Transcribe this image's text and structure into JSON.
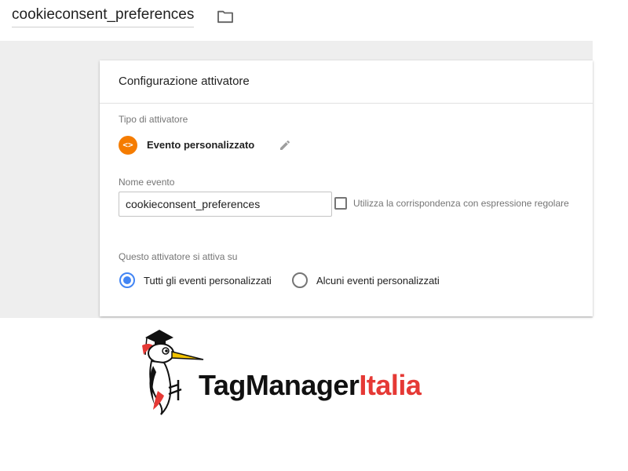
{
  "header": {
    "trigger_name": "cookieconsent_preferences",
    "folder_icon": "folder-icon"
  },
  "card": {
    "title": "Configurazione attivatore",
    "trigger_type": {
      "section_label": "Tipo di attivatore",
      "icon": "code-brackets-icon",
      "icon_glyph": "<>",
      "icon_color": "#f57c00",
      "label": "Evento personalizzato",
      "edit_icon": "pencil-icon"
    },
    "event_name": {
      "label": "Nome evento",
      "value": "cookieconsent_preferences"
    },
    "regex_option": {
      "label": "Utilizza la corrispondenza con espressione regolare",
      "checked": false
    },
    "fires_on": {
      "label": "Questo attivatore si attiva su",
      "options": [
        {
          "label": "Tutti gli eventi personalizzati",
          "selected": true
        },
        {
          "label": "Alcuni eventi personalizzati",
          "selected": false
        }
      ]
    }
  },
  "logo": {
    "text_part1": "TagManager",
    "text_part2": "Italia",
    "accent_color": "#e53935"
  },
  "colors": {
    "selected_radio": "#4285f4",
    "canvas_bg": "#eeeeee"
  }
}
